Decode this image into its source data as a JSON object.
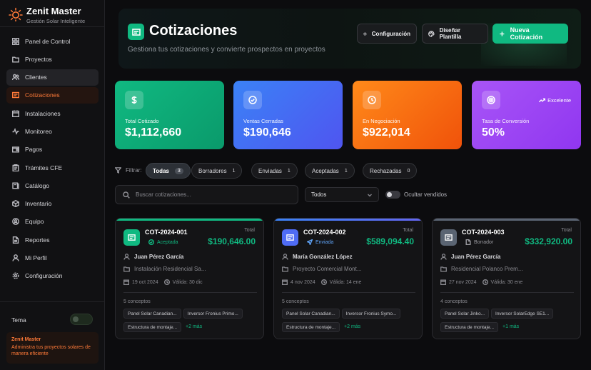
{
  "brand": {
    "name": "Zenit Master",
    "subtitle": "Gestión Solar Inteligente"
  },
  "sidebar": {
    "items": [
      {
        "label": "Panel de Control",
        "icon": "grid-icon"
      },
      {
        "label": "Proyectos",
        "icon": "folder-icon"
      },
      {
        "label": "Clientes",
        "icon": "users-icon"
      },
      {
        "label": "Cotizaciones",
        "icon": "quote-icon"
      },
      {
        "label": "Instalaciones",
        "icon": "calendar-icon"
      },
      {
        "label": "Monitoreo",
        "icon": "activity-icon"
      },
      {
        "label": "Pagos",
        "icon": "wallet-icon"
      },
      {
        "label": "Trámites CFE",
        "icon": "clipboard-icon"
      },
      {
        "label": "Catálogo",
        "icon": "book-icon"
      },
      {
        "label": "Inventario",
        "icon": "box-icon"
      },
      {
        "label": "Equipo",
        "icon": "team-icon"
      },
      {
        "label": "Reportes",
        "icon": "file-icon"
      },
      {
        "label": "Mi Perfil",
        "icon": "user-icon"
      },
      {
        "label": "Configuración",
        "icon": "gear-icon"
      }
    ],
    "active_index": 3,
    "theme_label": "Tema",
    "promo_title": "Zenit Master",
    "promo_text": "Administra tus proyectos solares de manera eficiente"
  },
  "header": {
    "title": "Cotizaciones",
    "subtitle": "Gestiona tus cotizaciones y convierte prospectos en proyectos",
    "btn_config": "Configuración",
    "btn_template": "Diseñar Plantilla",
    "btn_new": "Nueva Cotización"
  },
  "stats": [
    {
      "label": "Total Cotizado",
      "value": "$1,112,660",
      "color_from": "#10b981",
      "color_to": "#0a9a6b"
    },
    {
      "label": "Ventas Cerradas",
      "value": "$190,646",
      "color_from": "#3b82f6",
      "color_to": "#4f55f0"
    },
    {
      "label": "En Negociación",
      "value": "$922,014",
      "color_from": "#ff8a1a",
      "color_to": "#f0520a"
    },
    {
      "label": "Tasa de Conversión",
      "value": "50%",
      "badge": "Excelente",
      "color_from": "#a855f7",
      "color_to": "#9036f0"
    }
  ],
  "filters": {
    "label": "Filtrar:",
    "chips": [
      {
        "label": "Todas",
        "count": "3",
        "active": true
      },
      {
        "label": "Borradores",
        "count": "1"
      },
      {
        "label": "Enviadas",
        "count": "1"
      },
      {
        "label": "Aceptadas",
        "count": "1"
      },
      {
        "label": "Rechazadas",
        "count": "0"
      }
    ],
    "search_placeholder": "Buscar cotizaciones...",
    "select_value": "Todos",
    "hide_sold_label": "Ocultar vendidos"
  },
  "quotes": [
    {
      "code": "COT-2024-001",
      "status": "Aceptada",
      "status_color": "#10b981",
      "accent": "#10b981",
      "total_label": "Total",
      "total": "$190,646.00",
      "client": "Juan Pérez García",
      "project": "Instalación Residencial Sa...",
      "date": "19 oct 2024",
      "valid": "Válida: 30 dic",
      "concepts": "5 conceptos",
      "tags": [
        "Panel Solar Canadian...",
        "Inversor Fronius Primo...",
        "Estructura de montaje..."
      ],
      "more": "+2 más"
    },
    {
      "code": "COT-2024-002",
      "status": "Enviada",
      "status_color": "#60a5fa",
      "accent": "#4f6cf5",
      "total_label": "Total",
      "total": "$589,094.40",
      "client": "María González López",
      "project": "Proyecto Comercial Mont...",
      "date": "4 nov 2024",
      "valid": "Válida: 14 ene",
      "concepts": "5 conceptos",
      "tags": [
        "Panel Solar Canadian...",
        "Inversor Fronius Symo...",
        "Estructura de montaje..."
      ],
      "more": "+2 más"
    },
    {
      "code": "COT-2024-003",
      "status": "Borrador",
      "status_color": "#9a9aa0",
      "accent": "#5a6472",
      "total_label": "Total",
      "total": "$332,920.00",
      "client": "Juan Pérez García",
      "project": "Residencial Polanco Prem...",
      "date": "27 nov 2024",
      "valid": "Válida: 30 ene",
      "concepts": "4 conceptos",
      "tags": [
        "Panel Solar Jinko...",
        "Inversor SolarEdge SE1...",
        "Estructura de montaje..."
      ],
      "more": "+1 más"
    }
  ]
}
